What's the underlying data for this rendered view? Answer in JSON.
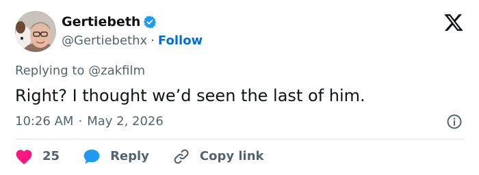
{
  "user": {
    "display_name": "Gertiebeth",
    "handle": "@Gertiebethx",
    "separator": "·",
    "follow_label": "Follow",
    "verified": true
  },
  "tweet": {
    "replying_prefix": "Replying to",
    "replying_handle": "@zakfilm",
    "text": "Right? I thought we’d seen the last of him.",
    "time": "10:26 AM",
    "date_separator": "·",
    "date": "May 2, 2026"
  },
  "actions": {
    "like_count": "25",
    "reply_label": "Reply",
    "copy_link_label": "Copy link"
  },
  "icons": {
    "verified": "verified-badge-icon",
    "brand": "x-logo-icon",
    "info": "info-icon",
    "like": "heart-icon",
    "reply": "speech-bubble-icon",
    "copy": "link-icon"
  },
  "colors": {
    "like": "#f91880",
    "reply": "#1d9bf0",
    "follow": "#006fd6",
    "verified": "#1d9bf0",
    "secondary_text": "#536471"
  }
}
